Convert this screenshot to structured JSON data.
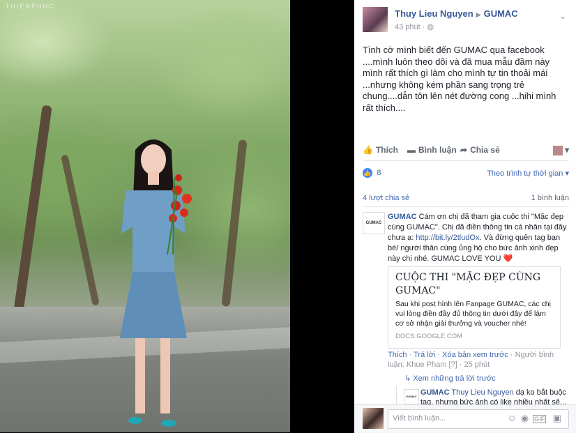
{
  "photo": {
    "watermark": "THIENPHUC"
  },
  "post": {
    "author": "Thuy Lieu Nguyen",
    "target": "GUMAC",
    "time": "43 phút",
    "privacy_icon": "globe-icon",
    "text": "Tình cờ mình biết đến GUMAC qua facebook ....mình luôn theo dõi và đã mua mẫu đầm này mình rất thích gì làm cho mình tự tin thoải mái ...nhưng không kém phần sang trọng trẻ chung....dẫn tôn lên nét đường cong ...hihi mình rất thích...."
  },
  "actions": {
    "like": "Thích",
    "comment": "Bình luận",
    "share": "Chia sẻ"
  },
  "reactions": {
    "count": "8",
    "sort": "Theo trình tự thời gian ▾"
  },
  "stats": {
    "shares": "4 lượt chia sẻ",
    "comments": "1 bình luận"
  },
  "comment": {
    "avatar_text": "GUMAC",
    "name": "GUMAC",
    "text_before": "Cám ơn chị đã tham gia cuộc thi \"Mặc đẹp cùng GUMAC\". Chị đã điền thông tin cá nhân tại đây chưa ạ: ",
    "link": "http://bit.ly/2tludOx",
    "text_after": ". Và đừng quên tag bạn bè/ người thân cùng ủng hộ cho bức ảnh xinh đẹp này chị nhé. GUMAC LOVE YOU ❤️",
    "card": {
      "title": "CUỘC THI \"MẶC ĐẸP CÙNG GUMAC\"",
      "desc": "Sau khi post hình lên Fanpage GUMAC, các chị vui lòng điền đầy đủ thông tin dưới đây để làm cơ sở nhận giải thưởng và voucher nhé!",
      "domain": "DOCS.GOOGLE.COM"
    },
    "links": {
      "like": "Thích",
      "reply": "Trả lời",
      "remove_preview": "Xóa bản xem trước",
      "responder": "Người bình luận: Khue Pham",
      "help": "[?]",
      "time": "25 phút"
    }
  },
  "replies": {
    "toggle": "↳ Xem những trả lời trước",
    "item": {
      "name": "GUMAC",
      "mention": "Thuy Lieu Nguyen",
      "text": "dạ ko bắt buộc tag, nhưng bức ảnh có like nhiều nhất sẽ..."
    }
  },
  "composer": {
    "placeholder": "Viết bình luận..."
  }
}
